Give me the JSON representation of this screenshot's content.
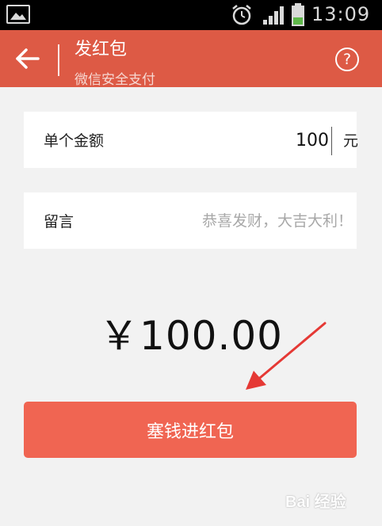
{
  "status_bar": {
    "time": "13:09",
    "icons": [
      "gallery-icon",
      "alarm-icon",
      "signal-icon",
      "battery-icon"
    ]
  },
  "header": {
    "back_icon": "arrow-left-icon",
    "title": "发红包",
    "subtitle": "微信安全支付",
    "help_icon": "question-circle-icon",
    "help_label": "?"
  },
  "form": {
    "amount_label": "单个金额",
    "amount_value": "100",
    "amount_unit": "元",
    "message_label": "留言",
    "message_placeholder": "恭喜发财，大吉大利！"
  },
  "total": "￥100.00",
  "submit": {
    "label": "塞钱进红包"
  },
  "watermark": {
    "text": "Bai 经验"
  },
  "colors": {
    "header": "#dd5a45",
    "button": "#f06552",
    "background": "#f2f2f2",
    "annotation": "#e53935"
  }
}
